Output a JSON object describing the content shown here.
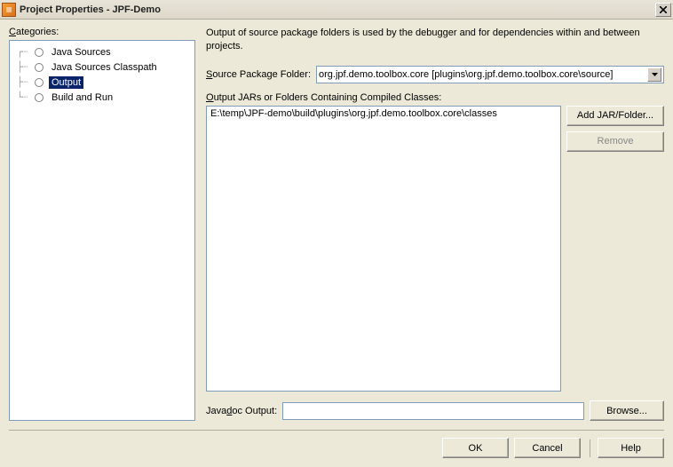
{
  "title": "Project Properties - JPF-Demo",
  "categories": {
    "label": "Categories:",
    "items": [
      {
        "label": "Java Sources"
      },
      {
        "label": "Java Sources Classpath"
      },
      {
        "label": "Output",
        "selected": true
      },
      {
        "label": "Build and Run"
      }
    ]
  },
  "main": {
    "description": "Output of source package folders is used by the debugger and for dependencies within and between projects.",
    "source_pkg_label": "Source Package Folder:",
    "source_pkg_value": "org.jpf.demo.toolbox.core [plugins\\org.jpf.demo.toolbox.core\\source]",
    "output_list_label": "Output JARs or Folders Containing Compiled Classes:",
    "output_items": [
      "E:\\temp\\JPF-demo\\build\\plugins\\org.jpf.demo.toolbox.core\\classes"
    ],
    "add_button": "Add JAR/Folder...",
    "remove_button": "Remove",
    "javadoc_label": "Javadoc Output:",
    "javadoc_value": "",
    "browse_button": "Browse..."
  },
  "footer": {
    "ok": "OK",
    "cancel": "Cancel",
    "help": "Help"
  }
}
